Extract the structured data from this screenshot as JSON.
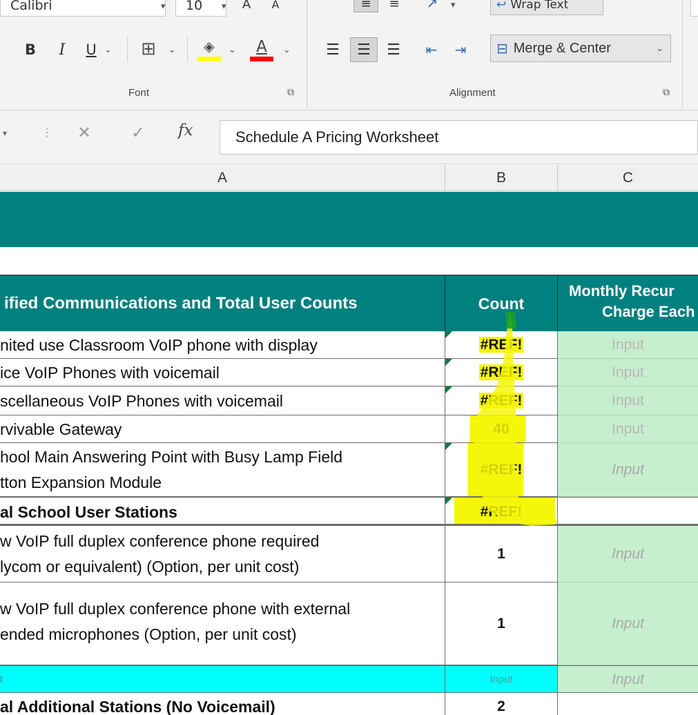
{
  "ribbon": {
    "font_name": "Calibri",
    "font_size": "10",
    "bold_label": "B",
    "italic_label": "I",
    "underline_label": "U",
    "font_color_letter": "A",
    "grow_font_label": "A",
    "shrink_font_label": "A",
    "wrap_text_label": "Wrap Text",
    "merge_center_label": "Merge & Center",
    "font_group_label": "Font",
    "alignment_group_label": "Alignment",
    "fill_color": "#ffff00",
    "font_color": "#ff0000"
  },
  "formula_bar": {
    "fx_label": "fx",
    "content": "Schedule A Pricing Worksheet"
  },
  "columns": [
    "A",
    "B",
    "C"
  ],
  "table": {
    "header": {
      "description": "ified Communications and Total User Counts",
      "count": "Count",
      "monthly_line1": "Monthly Recur",
      "monthly_line2": "Charge Each"
    },
    "rows": [
      {
        "description": "nited use Classroom VoIP phone with display",
        "count": "#REF!",
        "input": "Input"
      },
      {
        "description": "ice VoIP Phones with voicemail",
        "count": "#REF!",
        "input": "Input"
      },
      {
        "description": "scellaneous VoIP Phones with voicemail",
        "count": "#REF!",
        "input": "Input"
      },
      {
        "description": "rvivable Gateway",
        "count": "40",
        "input": "Input"
      },
      {
        "description_line1": "hool Main Answering Point with Busy Lamp Field",
        "description_line2": "tton Expansion Module",
        "count": "#REF!",
        "input": "Input"
      },
      {
        "description": "al School User Stations",
        "count": "#REF!"
      },
      {
        "description_line1": "w VoIP full duplex conference phone required",
        "description_line2": "lycom or equivalent) (Option, per unit cost)",
        "count": "1",
        "input": "Input"
      },
      {
        "description_line1": "w VoIP full duplex conference phone with external",
        "description_line2": "ended microphones (Option, per unit cost)",
        "count": "1",
        "input": "Input"
      },
      {
        "description": "t",
        "count": "Input",
        "input": "Input"
      },
      {
        "description": "al Additional Stations (No Voicemail)",
        "count": "2"
      }
    ]
  },
  "colors": {
    "teal": "#00807f",
    "input_green": "#c6efce",
    "cyan_row": "#00ffff",
    "highlight_yellow": "#f6f60a"
  }
}
